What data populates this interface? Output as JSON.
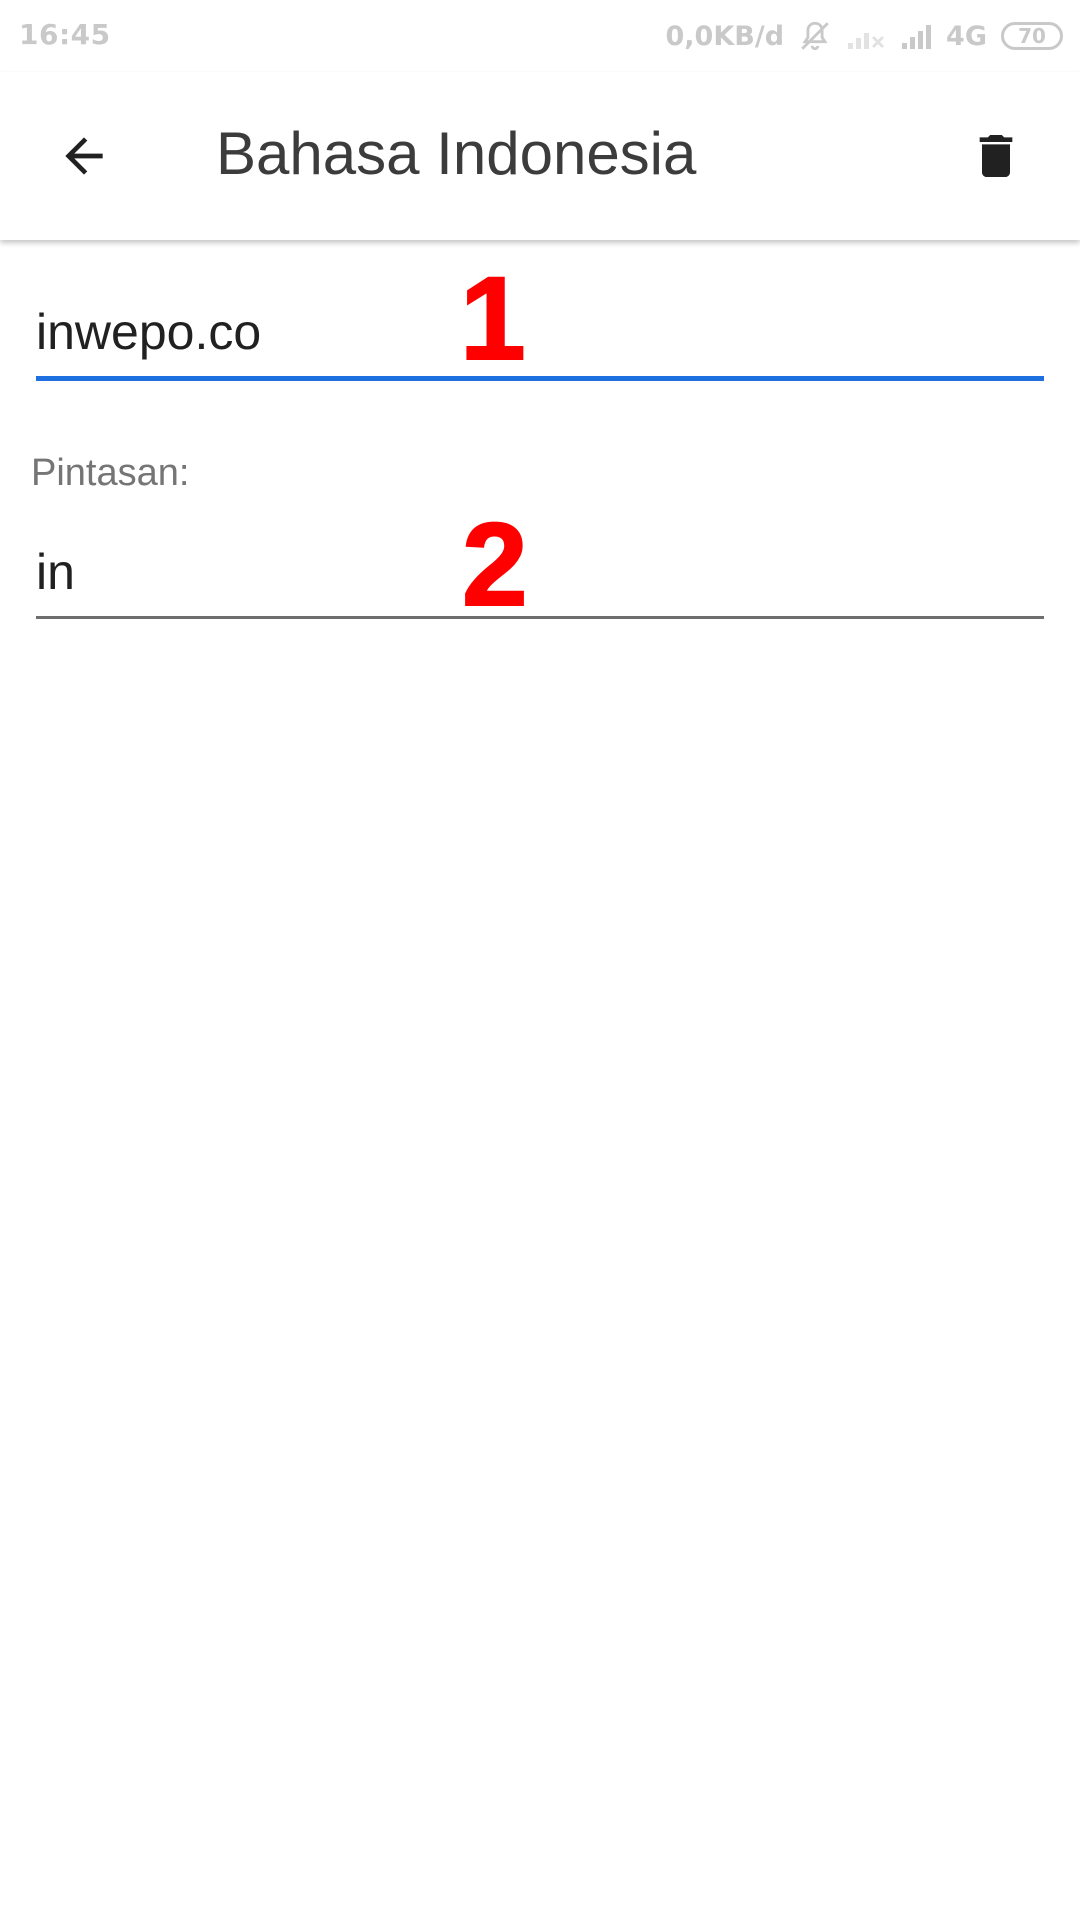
{
  "status_bar": {
    "time": "16:45",
    "net_speed": "0,0KB/d",
    "network_type": "4G",
    "battery_level": "70",
    "icons": [
      "muted-bell-icon",
      "signal-off-icon",
      "signal-icon"
    ]
  },
  "app_bar": {
    "title": "Bahasa Indonesia",
    "icons": [
      "back-arrow-icon",
      "trash-icon"
    ]
  },
  "form": {
    "text_value": "inwepo.co",
    "shortcut_label": "Pintasan:",
    "shortcut_value": "in"
  },
  "annotations": {
    "marker_1": "1",
    "marker_2": "2"
  },
  "colors": {
    "accent": "#1e6fe0",
    "annotation": "#ff0000",
    "title_text": "#3c3c3c",
    "status_text": "#c9c9c9"
  }
}
